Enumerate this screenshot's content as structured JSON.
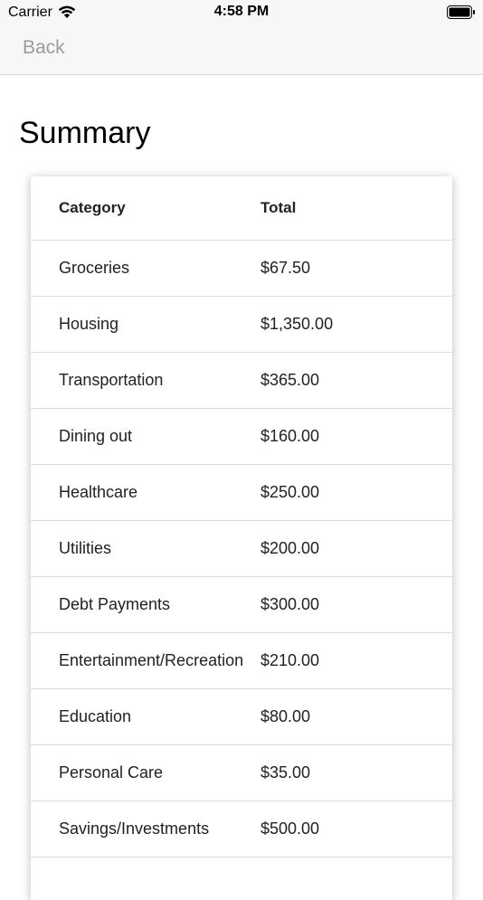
{
  "status_bar": {
    "carrier": "Carrier",
    "time": "4:58 PM"
  },
  "nav": {
    "back_label": "Back"
  },
  "page": {
    "title": "Summary"
  },
  "table": {
    "headers": {
      "category": "Category",
      "total": "Total"
    },
    "rows": [
      {
        "category": "Groceries",
        "total": "$67.50"
      },
      {
        "category": "Housing",
        "total": "$1,350.00"
      },
      {
        "category": "Transportation",
        "total": "$365.00"
      },
      {
        "category": "Dining out",
        "total": "$160.00"
      },
      {
        "category": "Healthcare",
        "total": "$250.00"
      },
      {
        "category": "Utilities",
        "total": "$200.00"
      },
      {
        "category": "Debt Payments",
        "total": "$300.00"
      },
      {
        "category": "Entertainment/Recreation",
        "total": "$210.00"
      },
      {
        "category": "Education",
        "total": "$80.00"
      },
      {
        "category": "Personal Care",
        "total": "$35.00"
      },
      {
        "category": "Savings/Investments",
        "total": "$500.00"
      }
    ]
  }
}
